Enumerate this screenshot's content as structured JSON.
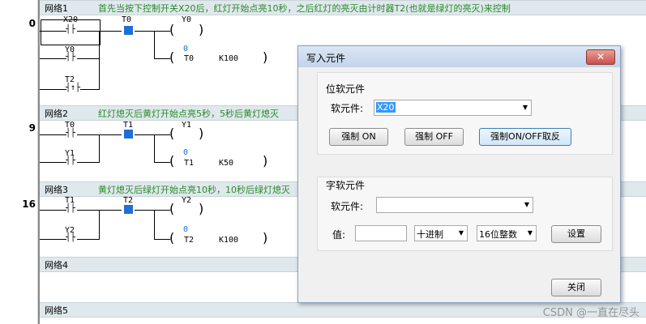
{
  "steps": [
    "0",
    "9",
    "16"
  ],
  "networks": [
    {
      "name": "网络1",
      "comment": "首先当按下控制开关X20后，红灯开始点亮10秒，之后红灯的亮灭由计时器T2(也就是绿灯的亮灭)来控制"
    },
    {
      "name": "网络2",
      "comment": "红灯熄灭后黄灯开始点亮5秒，5秒后黄灯熄灭"
    },
    {
      "name": "网络3",
      "comment": "黄灯熄灭后绿灯开始点亮10秒，10秒后绿灯熄灭"
    },
    {
      "name": "网络4",
      "comment": ""
    },
    {
      "name": "网络5",
      "comment": ""
    }
  ],
  "ladder": {
    "n1": {
      "c1": "X20",
      "c2": "Y0",
      "c3": "T2",
      "c4": "T0",
      "coil": "Y0",
      "tval": "0",
      "timer": "T0",
      "k": "K100"
    },
    "n2": {
      "c1": "T0",
      "c2": "Y1",
      "c3": "T1",
      "coil": "Y1",
      "tval": "0",
      "timer": "T1",
      "k": "K50"
    },
    "n3": {
      "c1": "T1",
      "c2": "Y2",
      "c3": "T2",
      "coil": "Y2",
      "tval": "0",
      "timer": "T2",
      "k": "K100"
    }
  },
  "dialog": {
    "title": "写入元件",
    "close": "✕",
    "bit_group": "位软元件",
    "bit_label": "软元件:",
    "bit_value": "X20",
    "btn_force_on": "强制 ON",
    "btn_force_off": "强制 OFF",
    "btn_toggle": "强制ON/OFF取反",
    "word_group": "字软元件",
    "word_label": "软元件:",
    "word_value": "",
    "value_label": "值:",
    "value_input": "",
    "radix": "十进制",
    "datatype": "16位整数",
    "btn_set": "设置",
    "btn_close": "关闭"
  },
  "watermark": "CSDN @一直在尽头"
}
